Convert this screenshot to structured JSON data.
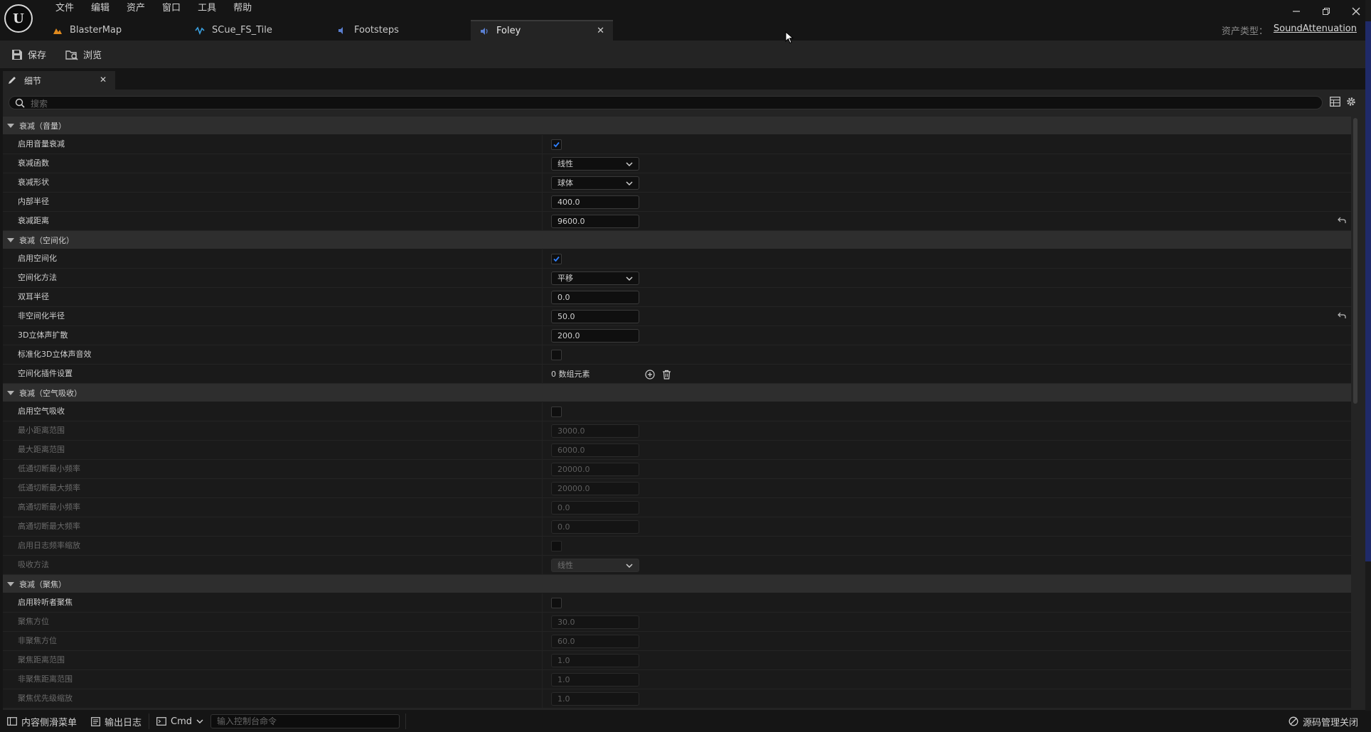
{
  "menu": [
    "文件",
    "编辑",
    "资产",
    "窗口",
    "工具",
    "帮助"
  ],
  "tabs": [
    {
      "label": "BlasterMap",
      "icon": "level-icon",
      "active": false
    },
    {
      "label": "SCue_FS_Tile",
      "icon": "sound-cue-icon",
      "active": false
    },
    {
      "label": "Footsteps",
      "icon": "sound-class-icon",
      "active": false
    },
    {
      "label": "Foley",
      "icon": "sound-attenuation-icon",
      "active": true
    }
  ],
  "asset_type": {
    "label": "资产类型：",
    "value": "SoundAttenuation"
  },
  "toolbar": {
    "save_label": "保存",
    "browse_label": "浏览"
  },
  "panel": {
    "title": "细节",
    "search_placeholder": "搜索"
  },
  "sections": [
    {
      "title": "衰减（音量）",
      "rows": [
        {
          "label": "启用音量衰减",
          "type": "checkbox",
          "checked": true
        },
        {
          "label": "衰减函数",
          "type": "dropdown",
          "value": "线性"
        },
        {
          "label": "衰减形状",
          "type": "dropdown",
          "value": "球体"
        },
        {
          "label": "内部半径",
          "type": "number",
          "value": "400.0"
        },
        {
          "label": "衰减距离",
          "type": "number",
          "value": "9600.0",
          "reset": true
        }
      ]
    },
    {
      "title": "衰减（空间化）",
      "rows": [
        {
          "label": "启用空间化",
          "type": "checkbox",
          "checked": true
        },
        {
          "label": "空间化方法",
          "type": "dropdown",
          "value": "平移"
        },
        {
          "label": "双耳半径",
          "type": "number",
          "value": "0.0"
        },
        {
          "label": "非空间化半径",
          "type": "number",
          "value": "50.0",
          "reset": true
        },
        {
          "label": "3D立体声扩散",
          "type": "number",
          "value": "200.0"
        },
        {
          "label": "标准化3D立体声音效",
          "type": "checkbox",
          "checked": false
        },
        {
          "label": "空间化插件设置",
          "type": "array",
          "value": "0 数组元素"
        }
      ]
    },
    {
      "title": "衰减（空气吸收）",
      "rows": [
        {
          "label": "启用空气吸收",
          "type": "checkbox",
          "checked": false
        },
        {
          "label": "最小距离范围",
          "type": "number",
          "value": "3000.0",
          "disabled": true
        },
        {
          "label": "最大距离范围",
          "type": "number",
          "value": "6000.0",
          "disabled": true
        },
        {
          "label": "低通切断最小频率",
          "type": "number",
          "value": "20000.0",
          "disabled": true
        },
        {
          "label": "低通切断最大频率",
          "type": "number",
          "value": "20000.0",
          "disabled": true
        },
        {
          "label": "高通切断最小频率",
          "type": "number",
          "value": "0.0",
          "disabled": true
        },
        {
          "label": "高通切断最大频率",
          "type": "number",
          "value": "0.0",
          "disabled": true
        },
        {
          "label": "启用日志频率缩放",
          "type": "checkbox",
          "checked": false,
          "disabled": true
        },
        {
          "label": "吸收方法",
          "type": "dropdown",
          "value": "线性",
          "disabled": true
        }
      ]
    },
    {
      "title": "衰减（聚焦）",
      "rows": [
        {
          "label": "启用聆听者聚焦",
          "type": "checkbox",
          "checked": false
        },
        {
          "label": "聚焦方位",
          "type": "number",
          "value": "30.0",
          "disabled": true
        },
        {
          "label": "非聚焦方位",
          "type": "number",
          "value": "60.0",
          "disabled": true
        },
        {
          "label": "聚焦距离范围",
          "type": "number",
          "value": "1.0",
          "disabled": true
        },
        {
          "label": "非聚焦距离范围",
          "type": "number",
          "value": "1.0",
          "disabled": true
        },
        {
          "label": "聚焦优先级缩放",
          "type": "number",
          "value": "1.0",
          "disabled": true
        }
      ]
    }
  ],
  "statusbar": {
    "content_drawer": "内容侧滑菜单",
    "output_log": "输出日志",
    "cmd": "Cmd",
    "console_placeholder": "输入控制台命令",
    "source_control": "源码管理关闭"
  },
  "colors": {
    "accent_check": "#2f80ff",
    "level_icon": "#e08a1e",
    "cue_icon": "#3aa0e0",
    "attenuation_icon": "#5a7fd0"
  }
}
